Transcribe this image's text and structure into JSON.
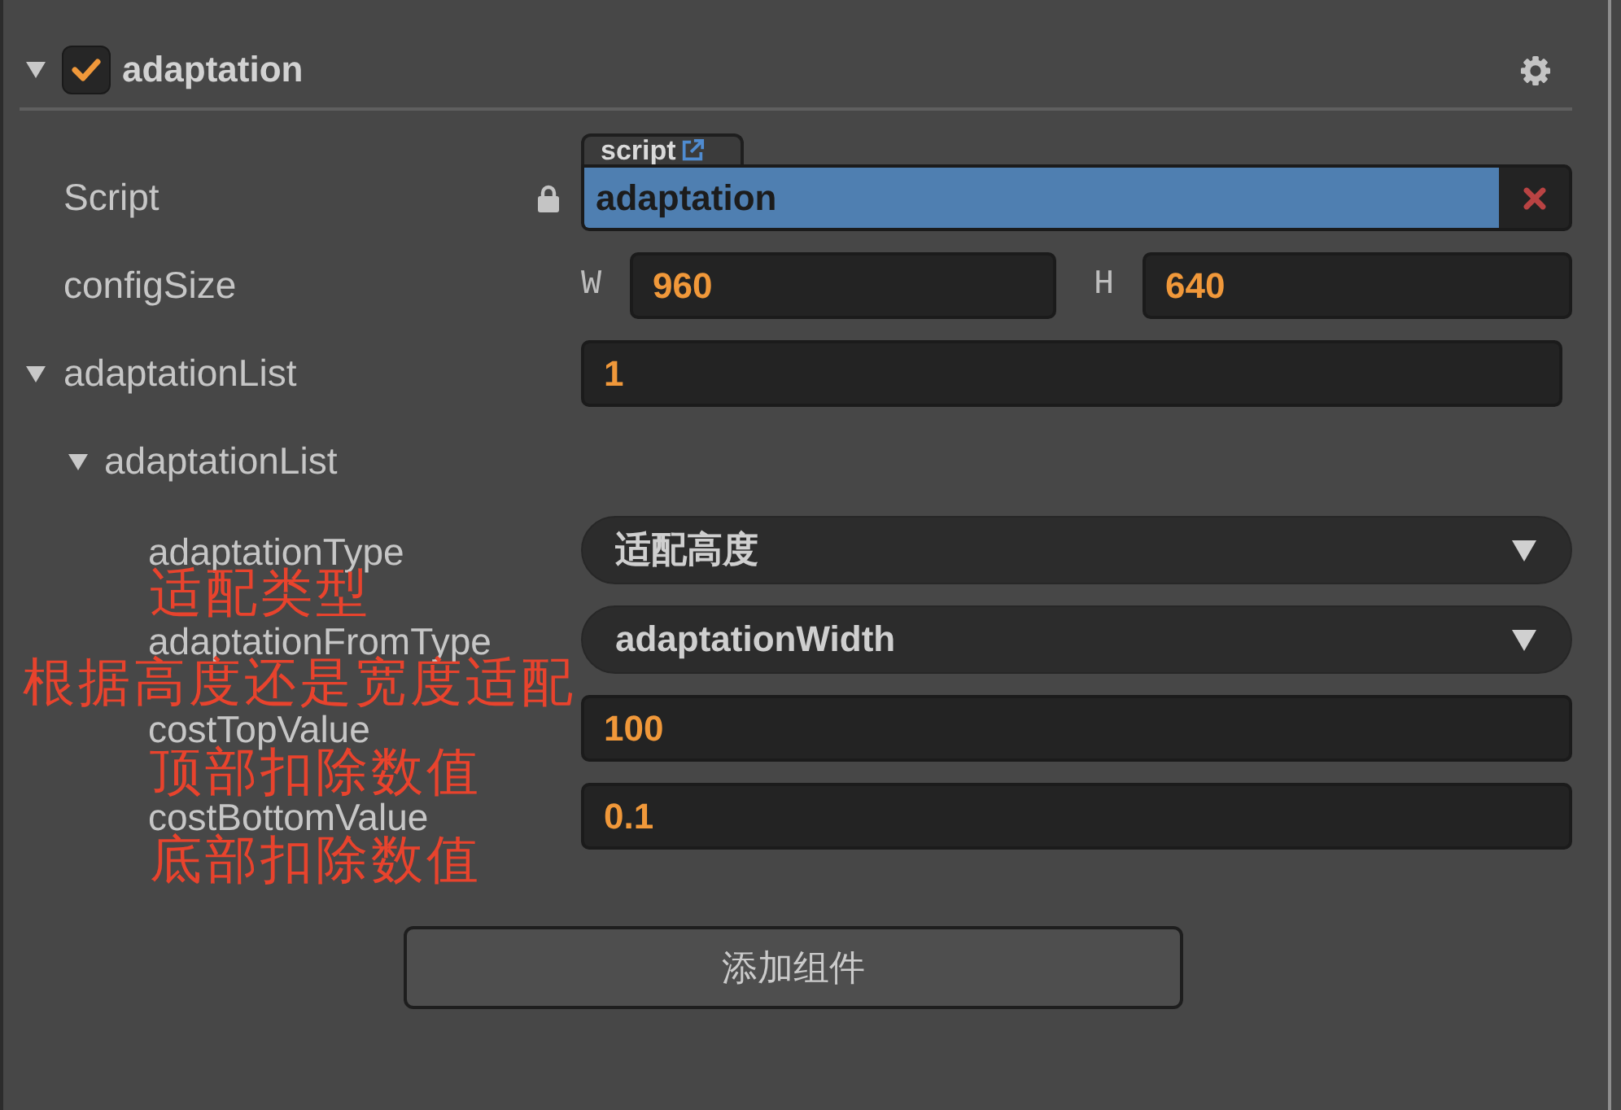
{
  "component": {
    "title": "adaptation",
    "expanded": true,
    "enabled": true
  },
  "script": {
    "label": "Script",
    "tab": "script",
    "value": "adaptation"
  },
  "config_size": {
    "label": "configSize",
    "fields": [
      {
        "axis": "W",
        "value": "960"
      },
      {
        "axis": "H",
        "value": "640"
      }
    ]
  },
  "adaptation_list": {
    "label": "adaptationList",
    "expanded": true,
    "value": "1",
    "children": [
      {
        "label": "adaptationList",
        "expanded": true,
        "properties": [
          {
            "label": "adaptationType",
            "kind": "dropdown",
            "value": "适配高度",
            "annotation": "适配类型"
          },
          {
            "label": "adaptationFromType",
            "kind": "dropdown",
            "value": "adaptationWidth",
            "annotation": "根据高度还是宽度适配"
          },
          {
            "label": "costTopValue",
            "kind": "number",
            "value": "100",
            "annotation": "顶部扣除数值"
          },
          {
            "label": "costBottomValue",
            "kind": "number",
            "value": "0.1",
            "annotation": "底部扣除数值"
          }
        ]
      }
    ]
  },
  "add_component_button": "添加组件"
}
